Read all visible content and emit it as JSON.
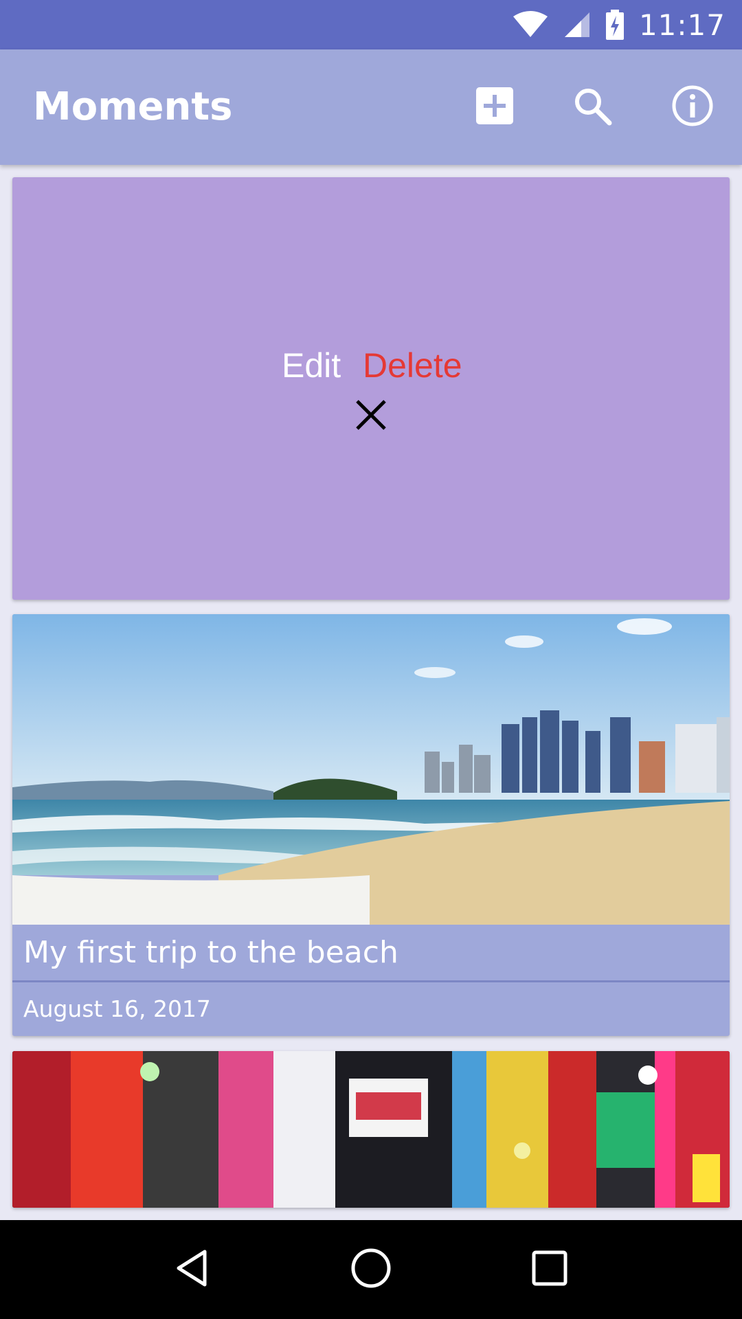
{
  "status_bar": {
    "time": "11:17",
    "icons": [
      "wifi-icon",
      "cell-signal-icon",
      "battery-charging-icon"
    ]
  },
  "app_bar": {
    "title": "Moments",
    "actions": [
      "add-box-icon",
      "search-icon",
      "info-icon"
    ]
  },
  "cards": [
    {
      "state": "options-open",
      "edit_label": "Edit",
      "delete_label": "Delete",
      "close_icon": "close-icon"
    },
    {
      "image": "beach-photo",
      "title": "My first trip to the beach",
      "date": "August 16, 2017"
    },
    {
      "image": "city-night-signs-photo"
    }
  ],
  "nav_bar": {
    "buttons": [
      "back-icon",
      "home-icon",
      "recents-icon"
    ]
  },
  "colors": {
    "status_bar": "#5F6BC2",
    "app_bar": "#9FA8DA",
    "options_card": "#B39DDB",
    "delete": "#E53935",
    "background": "#E8E8F4"
  }
}
